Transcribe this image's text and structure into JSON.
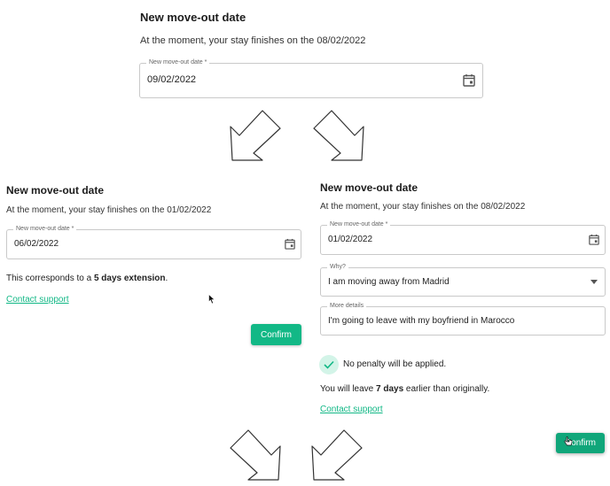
{
  "top": {
    "title": "New move-out date",
    "subtitle": "At the moment, your stay finishes on the 08/02/2022",
    "field_label": "New move-out date *",
    "field_value": "09/02/2022"
  },
  "left": {
    "title": "New move-out date",
    "subtitle": "At the moment, your stay finishes on the 01/02/2022",
    "field_label": "New move-out date *",
    "field_value": "06/02/2022",
    "extension_prefix": "This corresponds to a ",
    "extension_bold": "5 days extension",
    "extension_suffix": ".",
    "contact_link": "Contact support",
    "confirm_label": "Confirm"
  },
  "right": {
    "title": "New move-out date",
    "subtitle": "At the moment, your stay finishes on the 08/02/2022",
    "date_label": "New move-out date *",
    "date_value": "01/02/2022",
    "why_label": "Why?",
    "why_value": "I am moving away from Madrid",
    "details_label": "More details",
    "details_value": "I'm going to leave with my boyfriend in Marocco",
    "penalty_text": "No penalty will be applied.",
    "leave_prefix": "You will leave ",
    "leave_bold": "7 days",
    "leave_suffix": " earlier than originally.",
    "contact_link": "Contact support",
    "confirm_label": "Confirm"
  },
  "colors": {
    "accent": "#12b886",
    "accent_light": "#d3f4e8"
  },
  "icons": [
    "calendar-icon",
    "dropdown-caret-icon",
    "check-icon",
    "cursor-pointer-icon",
    "hand-pointer-icon",
    "down-left-arrow",
    "down-right-arrow"
  ]
}
